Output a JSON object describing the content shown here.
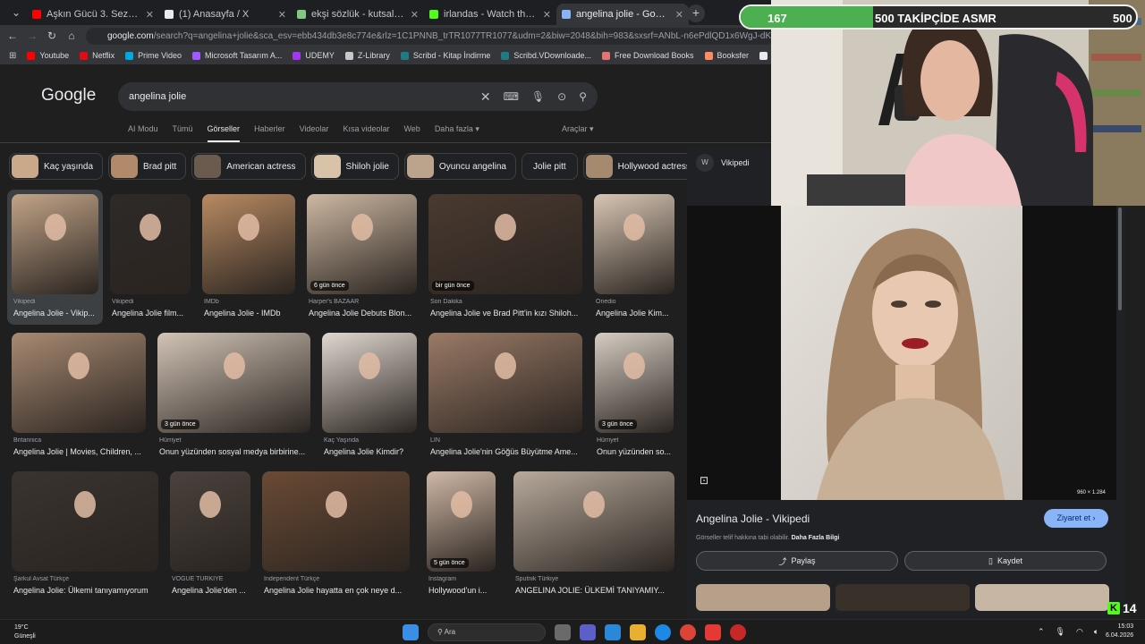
{
  "browser": {
    "tabs": [
      {
        "label": "Aşkın Gücü 3. Sezon 15. Bölüm",
        "favicon_color": "#ff0000",
        "active": false
      },
      {
        "label": "(1) Anasayfa / X",
        "favicon_color": "#e8eaed",
        "active": false
      },
      {
        "label": "ekşi sözlük - kutsal bilgi kaynağı",
        "favicon_color": "#81c784",
        "active": false
      },
      {
        "label": "irlandas - Watch the VOD on Kick",
        "favicon_color": "#53fc18",
        "active": false
      },
      {
        "label": "angelina jolie - Google'da Ara",
        "favicon_color": "#8ab4f8",
        "active": true
      }
    ],
    "url_host": "google.com",
    "url_rest": "/search?q=angelina+jolie&sca_esv=ebb434db3e8c774e&rlz=1C1PNNB_trTR1077TR1077&udm=2&biw=2048&bih=983&sxsrf=ANbL-n6ePdlQD1x6WgJ-dKmkMwtYlQdRw%3A17",
    "bookmarks": [
      {
        "label": "Youtube",
        "color": "#ff0000"
      },
      {
        "label": "Netflix",
        "color": "#e50914"
      },
      {
        "label": "Prime Video",
        "color": "#00a8e1"
      },
      {
        "label": "Microsoft Tasarım A...",
        "color": "#a259ff"
      },
      {
        "label": "UDEMY",
        "color": "#a435f0"
      },
      {
        "label": "Z-Library",
        "color": "#c8c8c8"
      },
      {
        "label": "Scribd - Kitap İndirme",
        "color": "#1e7b85"
      },
      {
        "label": "Scribd.VDownloade...",
        "color": "#1e7b85"
      },
      {
        "label": "Free Download Books",
        "color": "#e57373"
      },
      {
        "label": "Booksfer",
        "color": "#ff8a65"
      },
      {
        "label": "Anna's Archive",
        "color": "#e8eaed"
      },
      {
        "label": "El-Kitap",
        "color": "#4caf50"
      }
    ]
  },
  "google": {
    "logo": "Google",
    "query": "angelina jolie",
    "nav": [
      "AI Modu",
      "Tümü",
      "Görseller",
      "Haberler",
      "Videolar",
      "Kısa videolar",
      "Web",
      "Daha fazla ▾"
    ],
    "tools": "Araçlar ▾",
    "chips": [
      {
        "label": "Kaç yaşında",
        "color": "#c9a98a"
      },
      {
        "label": "Brad pitt",
        "color": "#b08a6a"
      },
      {
        "label": "American actress",
        "color": "#6b5a4e"
      },
      {
        "label": "Shiloh jolie",
        "color": "#d8c2a8"
      },
      {
        "label": "Oyuncu angelina",
        "color": "#bca38c"
      },
      {
        "label": "Jolie pitt",
        "color": ""
      },
      {
        "label": "Hollywood actress",
        "color": "#a58a70"
      }
    ]
  },
  "results": [
    {
      "source": "Vikipedi",
      "title": "Angelina Jolie - Vikip...",
      "badge": "",
      "color": "#c2a488"
    },
    {
      "source": "Vikipedi",
      "title": "Angelina Jolie film...",
      "badge": "",
      "color": "#2e2a28"
    },
    {
      "source": "IMDb",
      "title": "Angelina Jolie - IMDb",
      "badge": "",
      "color": "#b88a62"
    },
    {
      "source": "Harper's BAZAAR",
      "title": "Angelina Jolie Debuts Blon...",
      "badge": "6 gün önce",
      "color": "#cdb8a2"
    },
    {
      "source": "Son Dakika",
      "title": "Angelina Jolie ve Brad Pitt'in kızı Shiloh...",
      "badge": "bir gün önce",
      "color": "#4a3a30"
    },
    {
      "source": "Onedio",
      "title": "Angelina Jolie Kim...",
      "badge": "",
      "color": "#d8c6b4"
    },
    {
      "source": "Britannica",
      "title": "Angelina Jolie | Movies, Children, ...",
      "badge": "",
      "color": "#a88a72"
    },
    {
      "source": "Hürriyet",
      "title": "Onun yüzünden sosyal medya birbirine...",
      "badge": "3 gün önce",
      "color": "#d2c4b6"
    },
    {
      "source": "Kaç Yaşında",
      "title": "Angelina Jolie Kimdir?",
      "badge": "",
      "color": "#e0d8d0"
    },
    {
      "source": "LİN",
      "title": "Angelina Jolie'nin Göğüs Büyütme Ame...",
      "badge": "",
      "color": "#9a7a66"
    },
    {
      "source": "Hürriyet",
      "title": "Onun yüzünden so...",
      "badge": "3 gün önce",
      "color": "#d6ccc2"
    },
    {
      "source": "Şarkul Avsat Türkçe",
      "title": "Angelina Jolie: Ülkemi tanıyamıyorum",
      "badge": "",
      "color": "#3a3430"
    },
    {
      "source": "VOGUE TÜRKİYE",
      "title": "Angelina Jolie'den ...",
      "badge": "",
      "color": "#4a423c"
    },
    {
      "source": "Independent Türkçe",
      "title": "Angelina Jolie hayatta en çok neye d...",
      "badge": "",
      "color": "#6a4a34"
    },
    {
      "source": "Instagram",
      "title": "Hollywood'un i...",
      "badge": "5 gün önce",
      "color": "#d0b8a6"
    },
    {
      "source": "Sputnik Türkiye",
      "title": "ANGELINA JOLIE: ÜLKEMİ TANIYAMIY...",
      "badge": "",
      "color": "#b8aa9c"
    }
  ],
  "panel": {
    "site": "Vikipedi",
    "site_initial": "W",
    "dimensions": "960 × 1.284",
    "title": "Angelina Jolie - Vikipedi",
    "visit": "Ziyaret et ›",
    "note": "Görseller telif hakkına tabi olabilir.",
    "note_link": "Daha Fazla Bilgi",
    "share": "Paylaş",
    "save": "Kaydet"
  },
  "overlay": {
    "goal_current": "167",
    "goal_title": "500 TAKİPÇİDE ASMR",
    "goal_target": "500",
    "goal_progress": 0.334,
    "kick_count": "14"
  },
  "taskbar": {
    "temp": "19°C",
    "weather": "Güneşli",
    "search": "Ara",
    "time": "15:03",
    "date": "6.04.2026"
  }
}
